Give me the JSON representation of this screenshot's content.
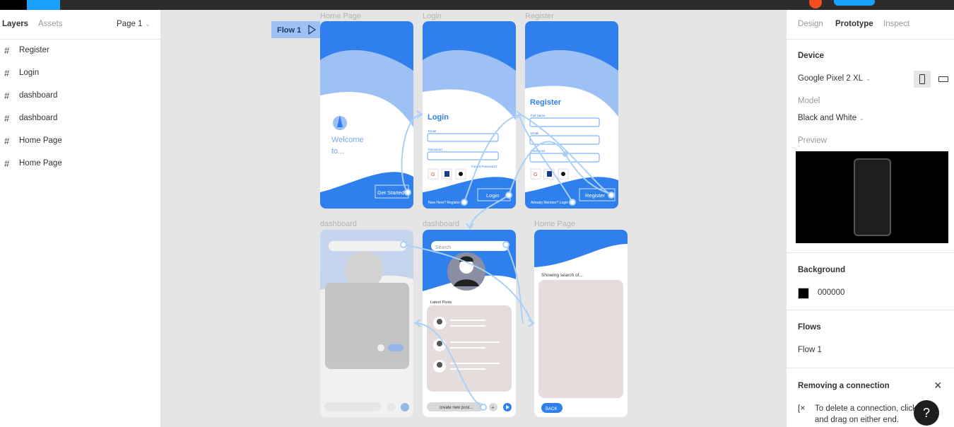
{
  "left_panel": {
    "tab_layers": "Layers",
    "tab_assets": "Assets",
    "page_selector": "Page 1",
    "layers": [
      {
        "name": "Register"
      },
      {
        "name": "Login"
      },
      {
        "name": "dashboard"
      },
      {
        "name": "dashboard"
      },
      {
        "name": "Home Page"
      },
      {
        "name": "Home Page"
      }
    ]
  },
  "canvas": {
    "flow_label": "Flow 1",
    "frames": {
      "home_top": "Home Page",
      "login": "Login",
      "register": "Register",
      "dash1": "dashboard",
      "dash2": "dashboard",
      "home_bottom": "Home Page"
    },
    "home": {
      "welcome": "Welcome",
      "to": "to...",
      "cta": "Get Started"
    },
    "login": {
      "title": "Login",
      "email_label": "Email",
      "password_label": "Password",
      "forgot": "Forgot Password?",
      "button": "Login",
      "footer": "New Here? Register"
    },
    "register": {
      "title": "Register",
      "fullname_label": "Full Name",
      "email_label": "Email",
      "password_label": "Password",
      "button": "Register",
      "footer": "Already Member? Login"
    },
    "dash": {
      "search": "Search",
      "latest_posts": "Latest Posts",
      "create_post": "create new post..."
    },
    "home2": {
      "showing": "Showing search of...",
      "back": "BACK"
    }
  },
  "right_panel": {
    "tab_design": "Design",
    "tab_prototype": "Prototype",
    "tab_inspect": "Inspect",
    "device_title": "Device",
    "device_value": "Google Pixel 2 XL",
    "model_label": "Model",
    "model_value": "Black and White",
    "preview_label": "Preview",
    "background_title": "Background",
    "background_value": "000000",
    "flows_title": "Flows",
    "flow_item": "Flow 1",
    "removing_title": "Removing a connection",
    "removing_text_1": "To delete a connection, click",
    "removing_text_2": "and drag on either end.",
    "help": "?"
  },
  "colors": {
    "accent": "#2f80ed",
    "accent_light": "#9dc0f5",
    "figma_blue": "#18a0fb",
    "connection": "#a9d1f7",
    "post_card": "#e6dcdc"
  }
}
